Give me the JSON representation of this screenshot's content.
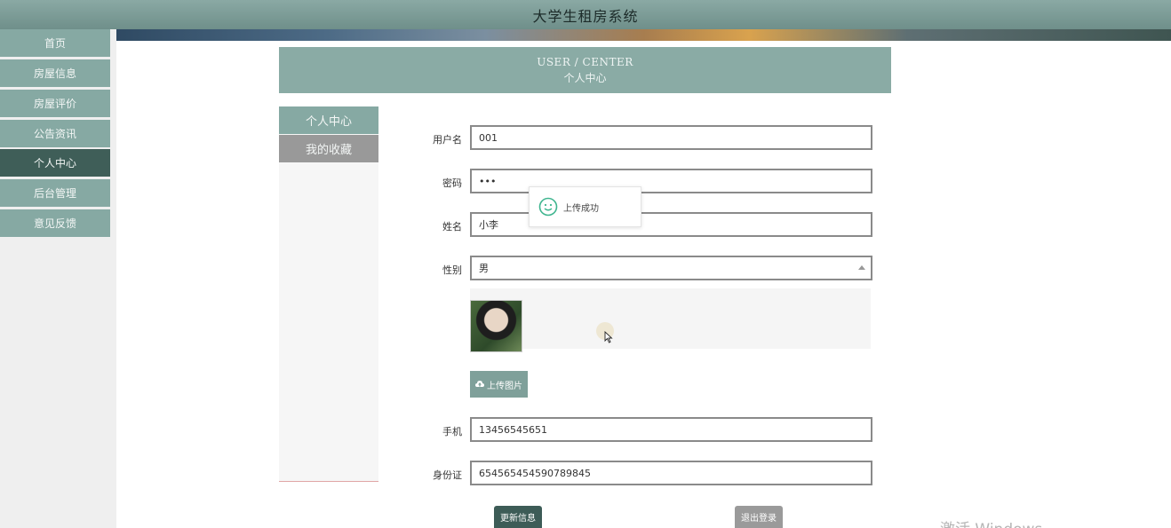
{
  "app": {
    "title": "大学生租房系统"
  },
  "nav": {
    "items": [
      {
        "label": "首页"
      },
      {
        "label": "房屋信息"
      },
      {
        "label": "房屋评价"
      },
      {
        "label": "公告资讯"
      },
      {
        "label": "个人中心",
        "active": true
      },
      {
        "label": "后台管理"
      },
      {
        "label": "意见反馈"
      }
    ]
  },
  "header": {
    "en": "USER / CENTER",
    "cn": "个人中心"
  },
  "subnav": {
    "profile": "个人中心",
    "favorites": "我的收藏"
  },
  "form": {
    "username_label": "用户名",
    "username_value": "001",
    "password_label": "密码",
    "password_value": "•••",
    "name_label": "姓名",
    "name_value": "小李",
    "gender_label": "性别",
    "gender_value": "男",
    "upload_label": "上传图片",
    "phone_label": "手机",
    "phone_value": "13456545651",
    "idcard_label": "身份证",
    "idcard_value": "654565454590789845"
  },
  "toast": {
    "message": "上传成功"
  },
  "actions": {
    "update": "更新信息",
    "logout": "退出登录"
  },
  "watermark": {
    "text": "激活 Windows"
  },
  "colors": {
    "primary": "#86a9a3",
    "primary_dark": "#3f5e58",
    "gray_button": "#9a9a9a"
  }
}
